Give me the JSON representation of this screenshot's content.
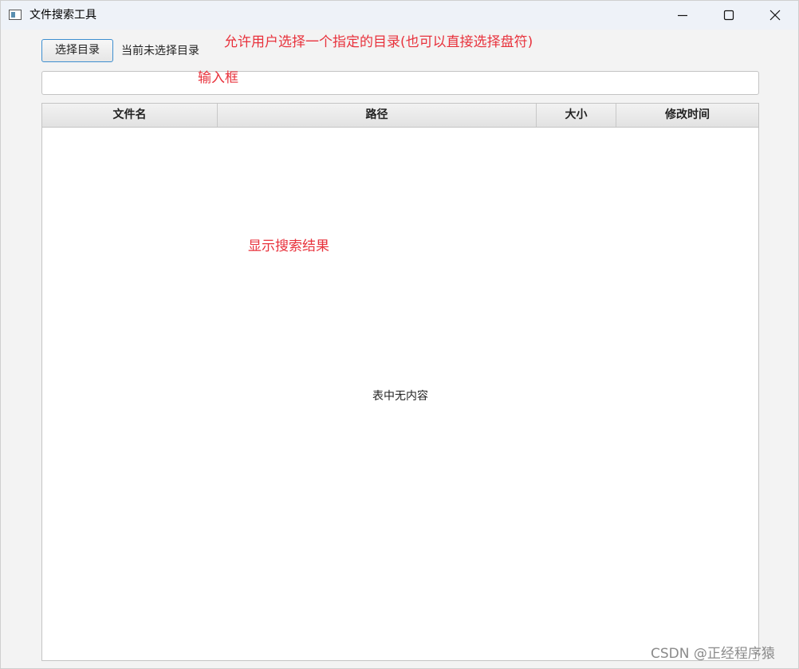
{
  "window": {
    "title": "文件搜索工具",
    "icon": "app-window-icon",
    "controls": {
      "minimize_icon": "minimize-icon",
      "maximize_icon": "maximize-icon",
      "close_icon": "close-icon"
    }
  },
  "toolbar": {
    "choose_dir_label": "选择目录",
    "dir_status": "当前未选择目录"
  },
  "search": {
    "value": "",
    "placeholder": ""
  },
  "table": {
    "columns": [
      "文件名",
      "路径",
      "大小",
      "修改时间"
    ],
    "rows": [],
    "empty_text": "表中无内容"
  },
  "annotations": {
    "choose_dir_note": "允许用户选择一个指定的目录(也可以直接选择盘符)",
    "input_note": "输入框",
    "results_note": "显示搜索结果"
  },
  "watermark": "CSDN @正经程序猿",
  "colors": {
    "annotation": "#e8323c",
    "button_border": "#3e8fd0",
    "window_bg": "#f3f3f3",
    "titlebar_bg": "#eef2f8"
  }
}
